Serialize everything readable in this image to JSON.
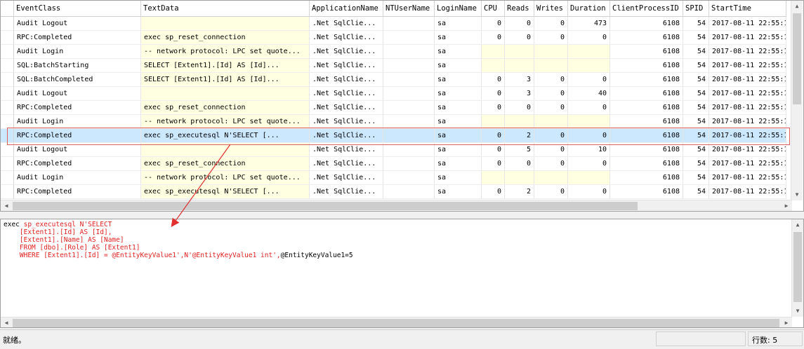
{
  "grid": {
    "columns": [
      "EventClass",
      "TextData",
      "ApplicationName",
      "NTUserName",
      "LoginName",
      "CPU",
      "Reads",
      "Writes",
      "Duration",
      "ClientProcessID",
      "SPID",
      "StartTime"
    ],
    "rows": [
      {
        "event": "Audit Logout",
        "text": "",
        "app": ".Net SqlClie...",
        "nt": "",
        "login": "sa",
        "cpu": "0",
        "reads": "0",
        "writes": "0",
        "duration": "473",
        "cpid": "6108",
        "spid": "54",
        "start": "2017-08-11 22:55:1"
      },
      {
        "event": "RPC:Completed",
        "text": "exec sp_reset_connection",
        "app": ".Net SqlClie...",
        "nt": "",
        "login": "sa",
        "cpu": "0",
        "reads": "0",
        "writes": "0",
        "duration": "0",
        "cpid": "6108",
        "spid": "54",
        "start": "2017-08-11 22:55:1"
      },
      {
        "event": "Audit Login",
        "text": "-- network protocol: LPC  set quote...",
        "app": ".Net SqlClie...",
        "nt": "",
        "login": "sa",
        "cpu": "",
        "reads": "",
        "writes": "",
        "duration": "",
        "cpid": "6108",
        "spid": "54",
        "start": "2017-08-11 22:55:1"
      },
      {
        "event": "SQL:BatchStarting",
        "text": "SELECT       [Extent1].[Id] AS [Id]...",
        "app": ".Net SqlClie...",
        "nt": "",
        "login": "sa",
        "cpu": "",
        "reads": "",
        "writes": "",
        "duration": "",
        "cpid": "6108",
        "spid": "54",
        "start": "2017-08-11 22:55:1"
      },
      {
        "event": "SQL:BatchCompleted",
        "text": "SELECT       [Extent1].[Id] AS [Id]...",
        "app": ".Net SqlClie...",
        "nt": "",
        "login": "sa",
        "cpu": "0",
        "reads": "3",
        "writes": "0",
        "duration": "0",
        "cpid": "6108",
        "spid": "54",
        "start": "2017-08-11 22:55:1"
      },
      {
        "event": "Audit Logout",
        "text": "",
        "app": ".Net SqlClie...",
        "nt": "",
        "login": "sa",
        "cpu": "0",
        "reads": "3",
        "writes": "0",
        "duration": "40",
        "cpid": "6108",
        "spid": "54",
        "start": "2017-08-11 22:55:1"
      },
      {
        "event": "RPC:Completed",
        "text": "exec sp_reset_connection",
        "app": ".Net SqlClie...",
        "nt": "",
        "login": "sa",
        "cpu": "0",
        "reads": "0",
        "writes": "0",
        "duration": "0",
        "cpid": "6108",
        "spid": "54",
        "start": "2017-08-11 22:55:1"
      },
      {
        "event": "Audit Login",
        "text": "-- network protocol: LPC  set quote...",
        "app": ".Net SqlClie...",
        "nt": "",
        "login": "sa",
        "cpu": "",
        "reads": "",
        "writes": "",
        "duration": "",
        "cpid": "6108",
        "spid": "54",
        "start": "2017-08-11 22:55:1"
      },
      {
        "event": "RPC:Completed",
        "text": "exec sp_executesql N'SELECT         [...",
        "app": ".Net SqlClie...",
        "nt": "",
        "login": "sa",
        "cpu": "0",
        "reads": "2",
        "writes": "0",
        "duration": "0",
        "cpid": "6108",
        "spid": "54",
        "start": "2017-08-11 22:55:1",
        "selected": true
      },
      {
        "event": "Audit Logout",
        "text": "",
        "app": ".Net SqlClie...",
        "nt": "",
        "login": "sa",
        "cpu": "0",
        "reads": "5",
        "writes": "0",
        "duration": "10",
        "cpid": "6108",
        "spid": "54",
        "start": "2017-08-11 22:55:1"
      },
      {
        "event": "RPC:Completed",
        "text": "exec sp_reset_connection",
        "app": ".Net SqlClie...",
        "nt": "",
        "login": "sa",
        "cpu": "0",
        "reads": "0",
        "writes": "0",
        "duration": "0",
        "cpid": "6108",
        "spid": "54",
        "start": "2017-08-11 22:55:1"
      },
      {
        "event": "Audit Login",
        "text": "-- network protocol: LPC  set quote...",
        "app": ".Net SqlClie...",
        "nt": "",
        "login": "sa",
        "cpu": "",
        "reads": "",
        "writes": "",
        "duration": "",
        "cpid": "6108",
        "spid": "54",
        "start": "2017-08-11 22:55:1"
      },
      {
        "event": "RPC:Completed",
        "text": "exec sp_executesql N'SELECT         [...",
        "app": ".Net SqlClie...",
        "nt": "",
        "login": "sa",
        "cpu": "0",
        "reads": "2",
        "writes": "0",
        "duration": "0",
        "cpid": "6108",
        "spid": "54",
        "start": "2017-08-11 22:55:1"
      }
    ]
  },
  "detail": {
    "line1_black": "exec",
    "line1_red": " sp_executesql N'SELECT",
    "line2": "    [Extent1].[Id] AS [Id],",
    "line3": "    [Extent1].[Name] AS [Name]",
    "line4": "    FROM [dbo].[Role] AS [Extent1]",
    "line5_red": "    WHERE [Extent1].[Id] = @EntityKeyValue1',N'@EntityKeyValue1 int',",
    "line5_black": "@EntityKeyValue1=5"
  },
  "status": {
    "message": "就绪。",
    "row_count": "行数: 5"
  },
  "colors": {
    "selection": "#cce8ff",
    "text_highlight": "#ffffe1",
    "annotation": "#e06060",
    "sql_text": "#e02020"
  }
}
